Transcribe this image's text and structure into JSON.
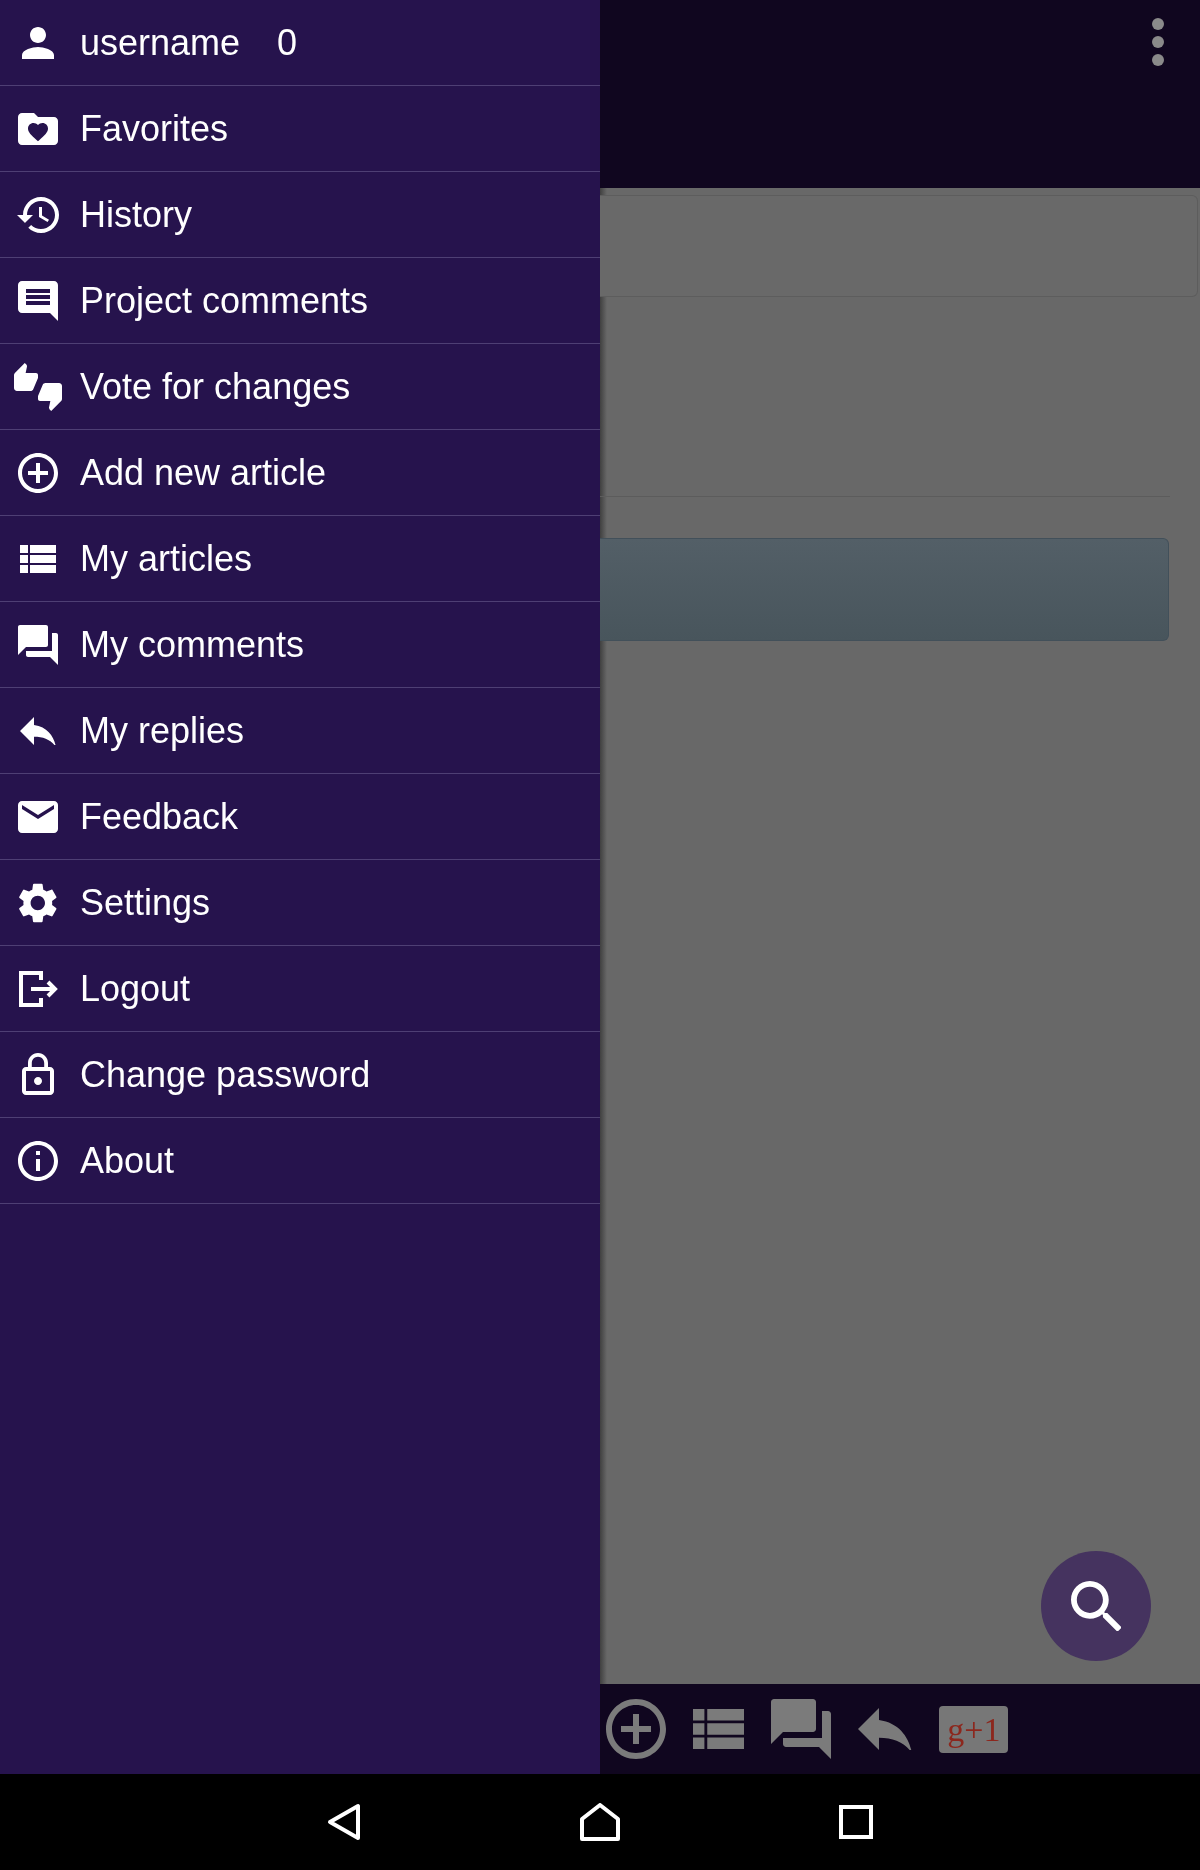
{
  "drawer": {
    "account": {
      "username": "username",
      "score": "0"
    },
    "items": [
      {
        "kind": "favorites",
        "label": "Favorites"
      },
      {
        "kind": "history",
        "label": "History"
      },
      {
        "kind": "discussion",
        "label": "Project comments"
      },
      {
        "kind": "vote",
        "label": "Vote for changes"
      },
      {
        "kind": "create",
        "label": "Add new article"
      },
      {
        "kind": "articles",
        "label": "My articles"
      },
      {
        "kind": "comments",
        "label": "My comments"
      },
      {
        "kind": "replies",
        "label": "My replies"
      },
      {
        "kind": "feedback",
        "label": "Feedback"
      },
      {
        "kind": "settings",
        "label": "Settings"
      },
      {
        "kind": "logout",
        "label": "Logout"
      },
      {
        "kind": "password",
        "label": "Change password"
      },
      {
        "kind": "about",
        "label": "About"
      }
    ]
  },
  "bottom_toolbar": {
    "items": [
      {
        "kind": "create"
      },
      {
        "kind": "articles"
      },
      {
        "kind": "comments"
      },
      {
        "kind": "replies"
      },
      {
        "kind": "plusone",
        "label": "g+1"
      }
    ]
  }
}
